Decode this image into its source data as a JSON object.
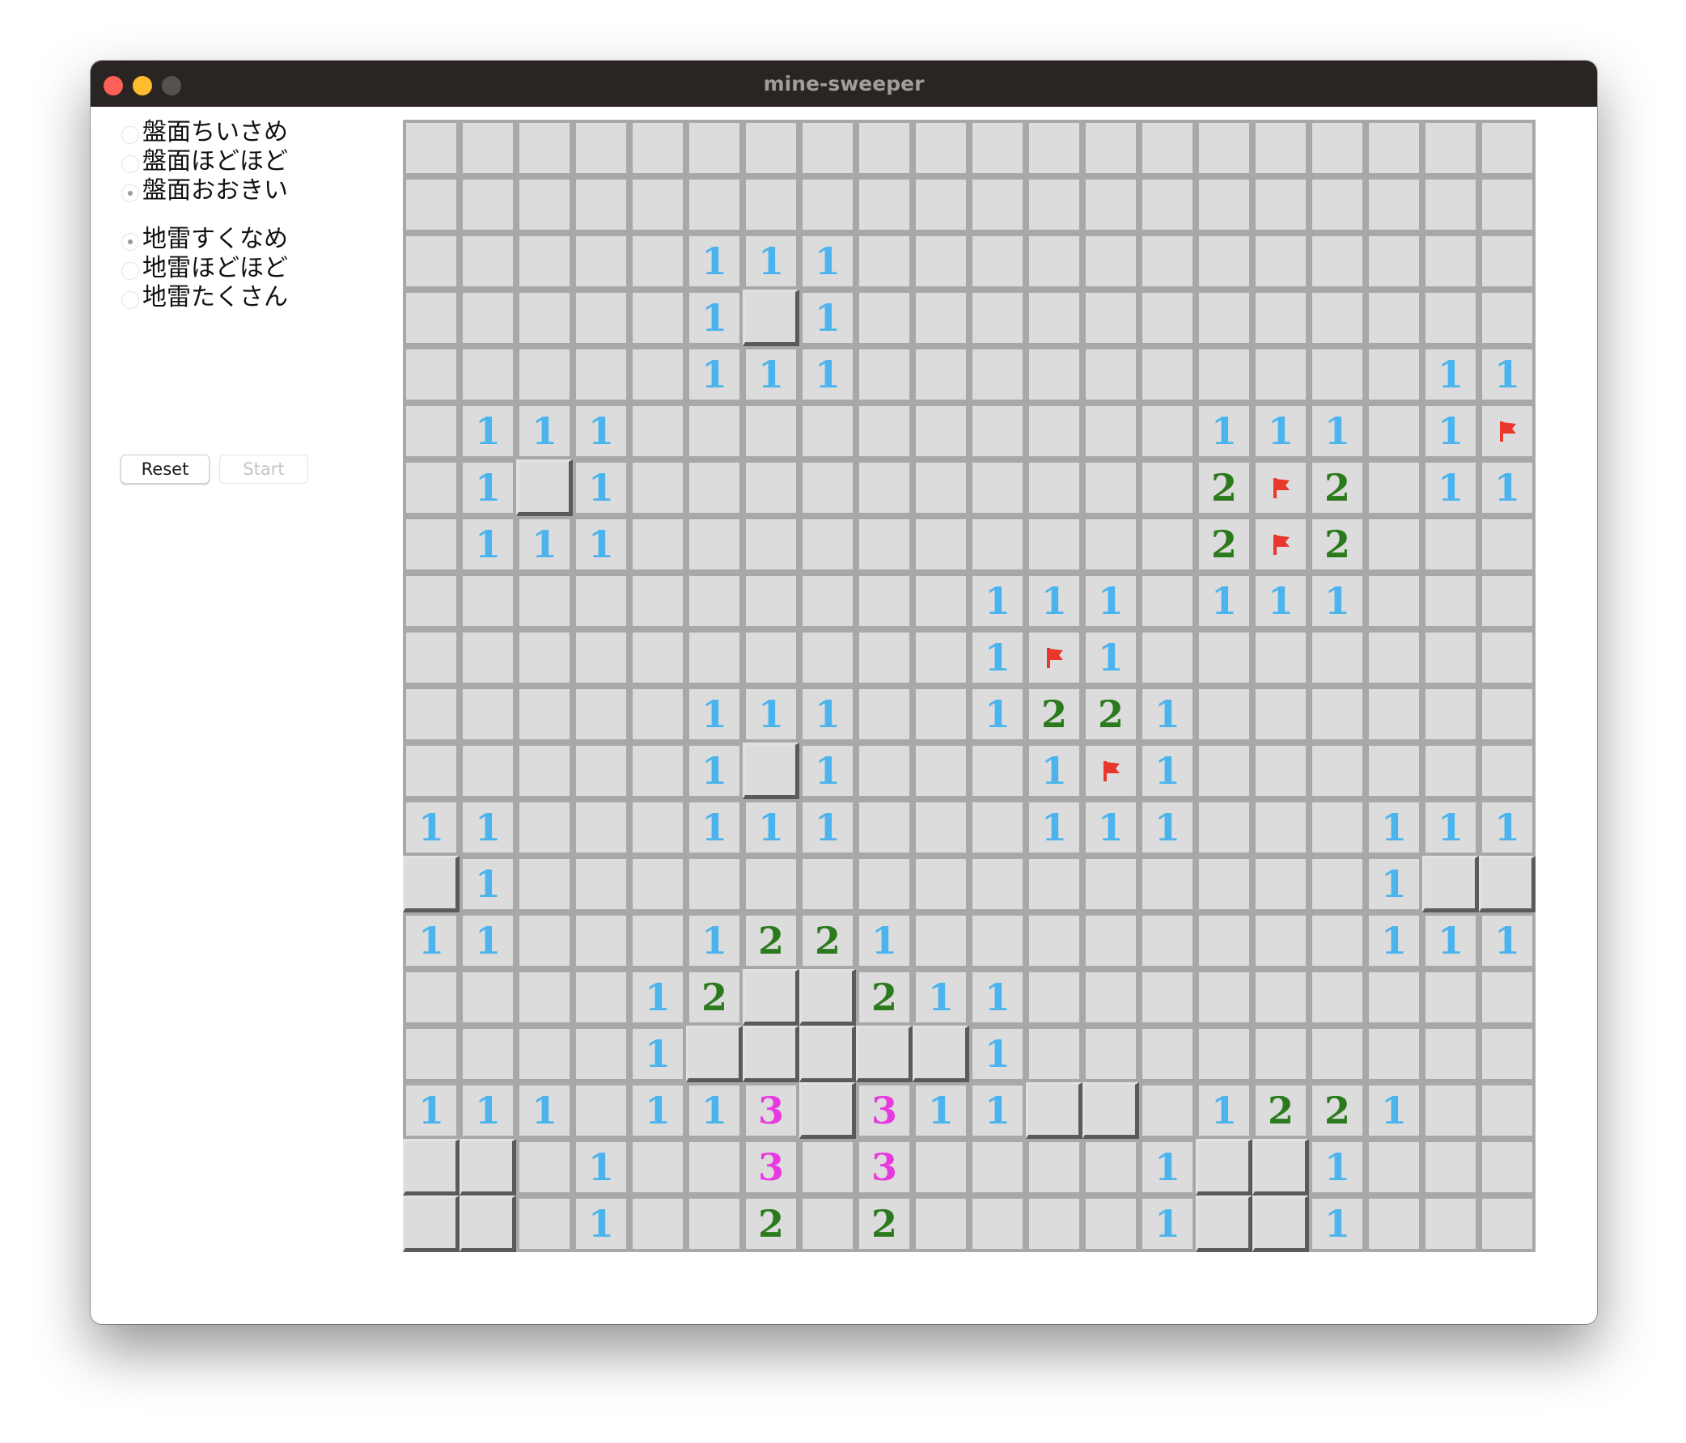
{
  "window": {
    "title": "mine-sweeper"
  },
  "settings": {
    "size_options": [
      {
        "label": "盤面ちいさめ",
        "selected": false
      },
      {
        "label": "盤面ほどほど",
        "selected": false
      },
      {
        "label": "盤面おおきい",
        "selected": true
      }
    ],
    "mine_options": [
      {
        "label": "地雷すくなめ",
        "selected": true
      },
      {
        "label": "地雷ほどほど",
        "selected": false
      },
      {
        "label": "地雷たくさん",
        "selected": false
      }
    ]
  },
  "buttons": {
    "reset_label": "Reset",
    "start_label": "Start",
    "start_disabled": true
  },
  "colors": {
    "one": "#4bb4ee",
    "two": "#2c7a1e",
    "three": "#e83ae0",
    "flag": "#e8372b",
    "cell": "#dcdcdc",
    "cell_border": "#a8a8a8"
  },
  "legend": {
    ".": "unopened",
    "0": "opened empty",
    "1": "one",
    "2": "two",
    "3": "three",
    "F": "flag"
  },
  "board": {
    "columns": 20,
    "rows": 20,
    "grid": [
      "....................",
      "....................",
      ".....111............",
      ".....101............",
      ".....111..........11",
      ".111..........111.1F",
      ".101..........2F2.11",
      ".111..........2F2...",
      "..........111.111...",
      "..........1F1.......",
      ".....111..1221......",
      ".....101...1F1......",
      "11...111...111...111",
      "01...............100",
      "11...1221........111",
      "....1200211.........",
      "....1000001.........",
      "111.113031100.1221..",
      "00.1..3.3....1001...",
      "00.1..2.2....1001..."
    ]
  }
}
